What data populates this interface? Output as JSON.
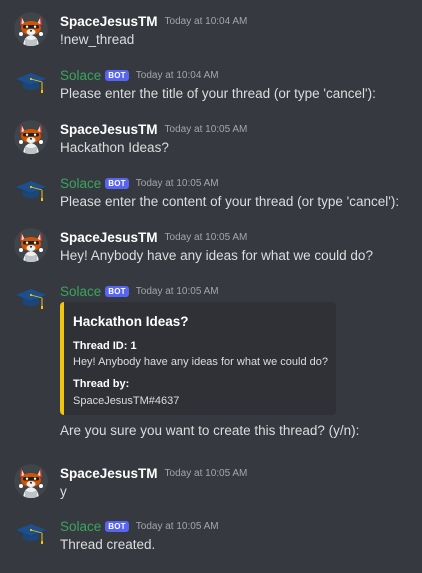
{
  "users": {
    "human": {
      "name": "SpaceJesusTM"
    },
    "bot": {
      "name": "Solace",
      "tag": "BOT"
    }
  },
  "colors": {
    "background": "#36393f",
    "bot_name": "#3ba55d",
    "bot_tag": "#5865f2",
    "embed_bg": "#2f3136",
    "embed_accent": "#f1c40f"
  },
  "icons": {
    "human_avatar": "red-fox-avatar-icon",
    "bot_avatar": "graduation-cap-icon"
  },
  "messages": [
    {
      "author": "SpaceJesusTM",
      "time": "Today at 10:04 AM",
      "text": "!new_thread"
    },
    {
      "author": "Solace",
      "bot_tag": "BOT",
      "time": "Today at 10:04 AM",
      "text": "Please enter the title of your thread (or type 'cancel'):"
    },
    {
      "author": "SpaceJesusTM",
      "time": "Today at 10:05 AM",
      "text": "Hackathon Ideas?"
    },
    {
      "author": "Solace",
      "bot_tag": "BOT",
      "time": "Today at 10:05 AM",
      "text": "Please enter the content of your thread (or type 'cancel'):"
    },
    {
      "author": "SpaceJesusTM",
      "time": "Today at 10:05 AM",
      "text": "Hey! Anybody have any ideas for what we could do?"
    },
    {
      "author": "Solace",
      "bot_tag": "BOT",
      "time": "Today at 10:05 AM",
      "embed": {
        "title": "Hackathon Ideas?",
        "fields": [
          {
            "name": "Thread ID: 1",
            "value": "Hey! Anybody have any ideas for what we could do?"
          },
          {
            "name": "Thread by:",
            "value": "SpaceJesusTM#4637"
          }
        ]
      },
      "text": "Are you sure you want to create this thread? (y/n):"
    },
    {
      "author": "SpaceJesusTM",
      "time": "Today at 10:05 AM",
      "text": "y"
    },
    {
      "author": "Solace",
      "bot_tag": "BOT",
      "time": "Today at 10:05 AM",
      "text": "Thread created."
    }
  ]
}
